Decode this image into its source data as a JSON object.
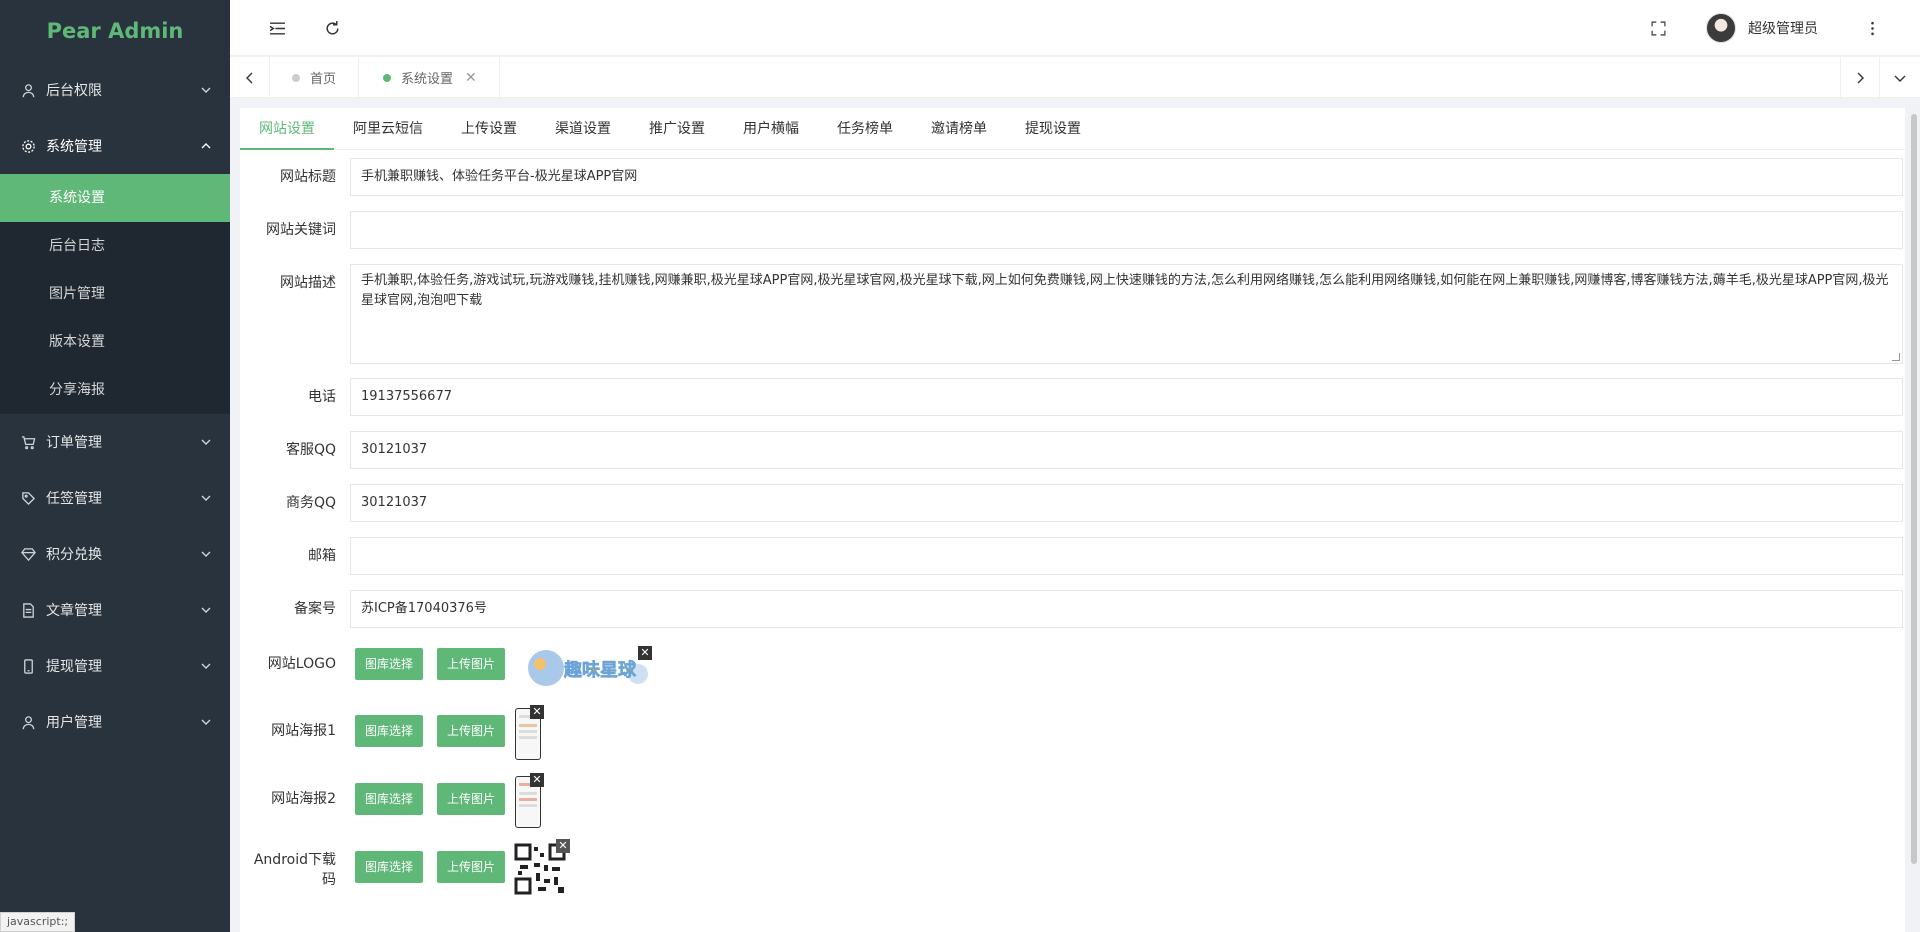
{
  "app": {
    "title": "Pear Admin"
  },
  "sidebar": {
    "items": [
      {
        "label": "后台权限",
        "icon": "user-icon"
      },
      {
        "label": "系统管理",
        "icon": "gear-icon",
        "open": true,
        "children": [
          "系统设置",
          "后台日志",
          "图片管理",
          "版本设置",
          "分享海报"
        ]
      },
      {
        "label": "订单管理",
        "icon": "cart-icon"
      },
      {
        "label": "任签管理",
        "icon": "tag-icon"
      },
      {
        "label": "积分兑换",
        "icon": "diamond-icon"
      },
      {
        "label": "文章管理",
        "icon": "document-icon"
      },
      {
        "label": "提现管理",
        "icon": "mobile-icon"
      },
      {
        "label": "用户管理",
        "icon": "user-icon"
      }
    ],
    "active_child": "系统设置"
  },
  "header": {
    "username": "超级管理员"
  },
  "page_tabs": [
    {
      "label": "首页"
    },
    {
      "label": "系统设置",
      "active": true
    }
  ],
  "settings_tabs": [
    "网站设置",
    "阿里云短信",
    "上传设置",
    "渠道设置",
    "推广设置",
    "用户横幅",
    "任务榜单",
    "邀请榜单",
    "提现设置"
  ],
  "form": {
    "site_title": {
      "label": "网站标题",
      "value": "手机兼职赚钱、体验任务平台-极光星球APP官网"
    },
    "keywords": {
      "label": "网站关键词",
      "value": ""
    },
    "description": {
      "label": "网站描述",
      "value": "手机兼职,体验任务,游戏试玩,玩游戏赚钱,挂机赚钱,网赚兼职,极光星球APP官网,极光星球官网,极光星球下载,网上如何免费赚钱,网上快速赚钱的方法,怎么利用网络赚钱,怎么能利用网络赚钱,如何能在网上兼职赚钱,网赚博客,博客赚钱方法,薅羊毛,极光星球APP官网,极光星球官网,泡泡吧下载"
    },
    "phone": {
      "label": "电话",
      "value": "19137556677"
    },
    "service_qq": {
      "label": "客服QQ",
      "value": "30121037"
    },
    "business_qq": {
      "label": "商务QQ",
      "value": "30121037"
    },
    "email": {
      "label": "邮箱",
      "value": ""
    },
    "icp": {
      "label": "备案号",
      "value": "苏ICP备17040376号"
    },
    "logo": {
      "label": "网站LOGO",
      "image_text": "趣味星球"
    },
    "poster1": {
      "label": "网站海报1"
    },
    "poster2": {
      "label": "网站海报2"
    },
    "android_qr": {
      "label": "Android下载码"
    }
  },
  "buttons": {
    "library": "图库选择",
    "upload": "上传图片"
  },
  "status_bar": "javascript:;",
  "colors": {
    "accent": "#5fb878",
    "sidebar_bg": "#28333e",
    "submenu_bg": "#1f2830"
  }
}
